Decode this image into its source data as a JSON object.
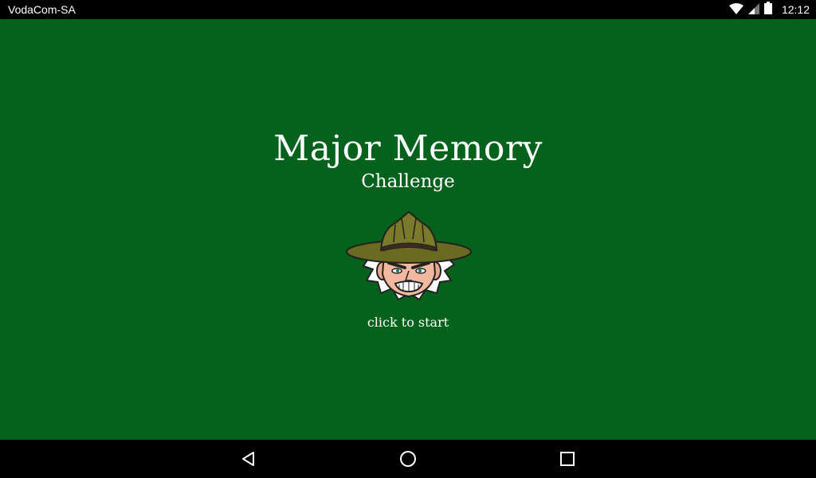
{
  "status_bar": {
    "carrier": "VodaCom-SA",
    "time": "12:12",
    "icons": [
      "wifi-icon",
      "cell-signal-icon",
      "battery-icon"
    ]
  },
  "app": {
    "title": "Major Memory",
    "subtitle": "Challenge",
    "start_label": "click to start",
    "mascot": "drill-sergeant-mascot",
    "background_color": "#05621d"
  },
  "nav_bar": {
    "buttons": [
      "back-icon",
      "home-icon",
      "recents-icon"
    ]
  }
}
